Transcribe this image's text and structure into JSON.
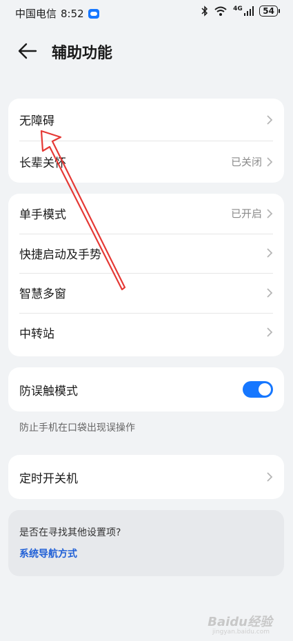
{
  "status_bar": {
    "carrier": "中国电信",
    "time": "8:52",
    "network": "4G",
    "battery": "54"
  },
  "header": {
    "title": "辅助功能"
  },
  "sections": {
    "group1": [
      {
        "label": "无障碍",
        "value": ""
      },
      {
        "label": "长辈关怀",
        "value": "已关闭"
      }
    ],
    "group2": [
      {
        "label": "单手模式",
        "value": "已开启"
      },
      {
        "label": "快捷启动及手势",
        "value": ""
      },
      {
        "label": "智慧多窗",
        "value": ""
      },
      {
        "label": "中转站",
        "value": ""
      }
    ],
    "group3": {
      "label": "防误触模式",
      "toggle_on": true,
      "hint": "防止手机在口袋出现误操作"
    },
    "group4": {
      "label": "定时开关机"
    }
  },
  "suggestion": {
    "question": "是否在寻找其他设置项?",
    "link": "系统导航方式"
  },
  "colors": {
    "accent": "#1677ff",
    "annotation": "#e53935",
    "link": "#1f5fd6"
  },
  "watermark": {
    "brand": "Baidu经验",
    "url": "jingyan.baidu.com"
  }
}
